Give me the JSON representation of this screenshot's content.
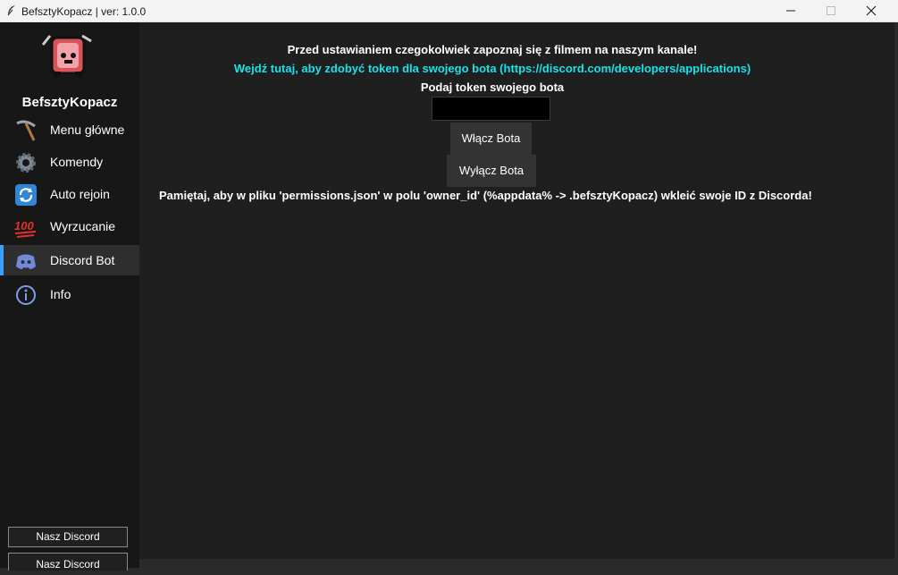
{
  "window": {
    "title": "BefsztyKopacz | ver: 1.0.0"
  },
  "sidebar": {
    "app_name": "BefsztyKopacz",
    "items": [
      {
        "label": "Menu główne",
        "icon": "pickaxe-icon"
      },
      {
        "label": "Komendy",
        "icon": "gear-icon"
      },
      {
        "label": "Auto rejoin",
        "icon": "refresh-icon"
      },
      {
        "label": "Wyrzucanie",
        "icon": "hundred-points-icon"
      },
      {
        "label": "Discord Bot",
        "icon": "discord-icon",
        "active": true
      },
      {
        "label": "Info",
        "icon": "info-icon"
      }
    ],
    "discord_button": "Nasz Discord",
    "discord_button_2": "Nasz Discord"
  },
  "main": {
    "intro": "Przed ustawianiem czegokolwiek zapoznaj się z filmem na naszym kanale!",
    "link": "Wejdź tutaj, aby zdobyć token dla swojego bota (https://discord.com/developers/applications)",
    "token_label": "Podaj token swojego bota",
    "token_value": "",
    "start_button": "Włącz Bota",
    "stop_button": "Wyłącz Bota",
    "note": "Pamiętaj, aby w pliku 'permissions.json' w polu 'owner_id' (%appdata% -> .befsztyKopacz) wkleić swoje ID z Discorda!"
  },
  "colors": {
    "link": "#19e3e9",
    "active_accent": "#3aa0ff"
  }
}
